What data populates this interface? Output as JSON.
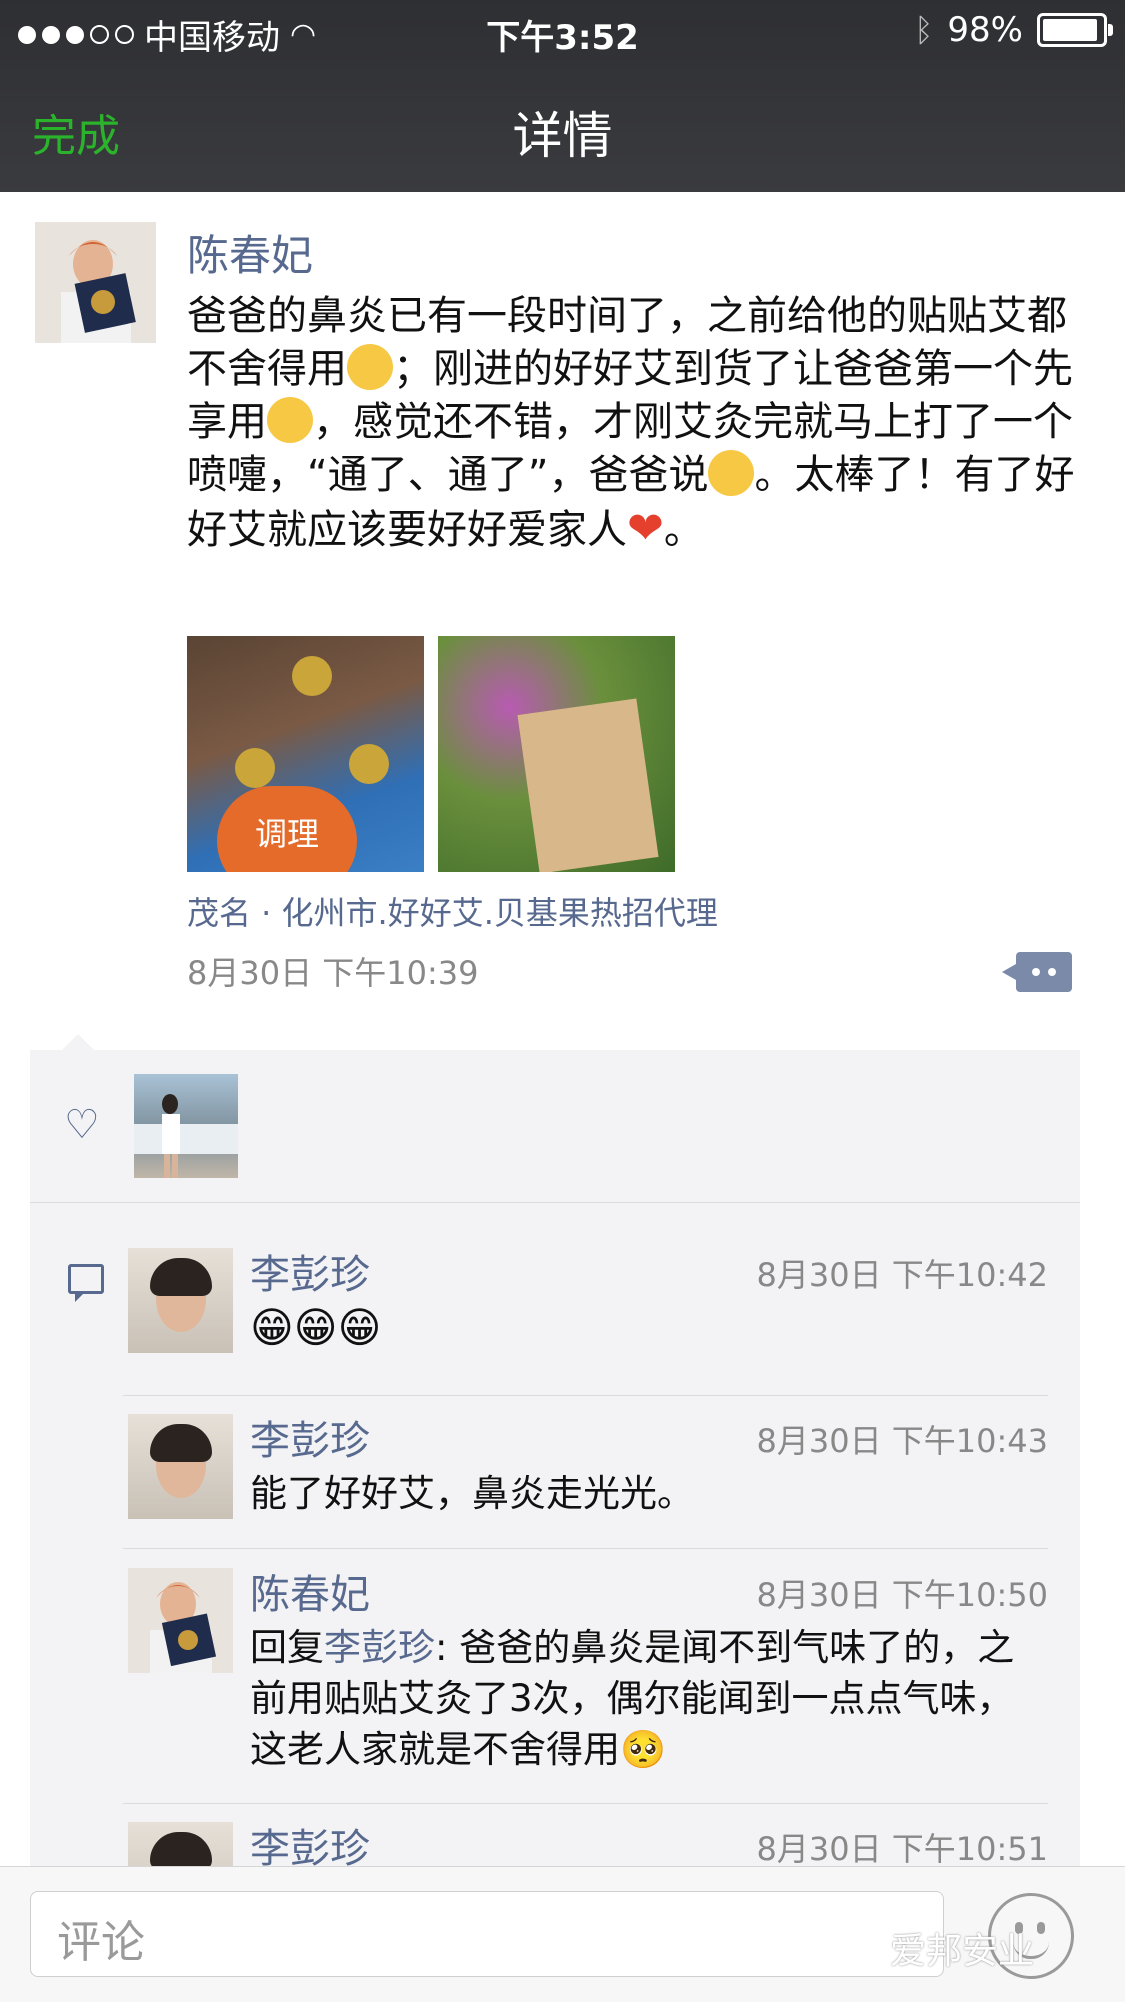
{
  "status_bar": {
    "carrier": "中国移动",
    "time": "下午3:52",
    "battery": "98%"
  },
  "nav": {
    "done_label": "完成",
    "title": "详情"
  },
  "post": {
    "author": "陈春妃",
    "text_parts": [
      "爸爸的鼻炎已有一段时间了，之前给他的贴贴艾都不舍得用",
      "；刚进的好好艾到货了让爸爸第一个先享用",
      "，感觉还不错，才刚艾灸完就马上打了一个喷嚏，“通了、通了”，爸爸说",
      "。太棒了！有了好好艾就应该要好好爱家人",
      "。"
    ],
    "photo1_tag": "调理",
    "location": "茂名 · 化州市.好好艾.贝基果热招代理",
    "timestamp": "8月30日 下午10:39"
  },
  "comments": [
    {
      "name": "李彭珍",
      "time": "8月30日 下午10:42",
      "text": "😁😁😁"
    },
    {
      "name": "李彭珍",
      "time": "8月30日 下午10:43",
      "text": "能了好好艾，鼻炎走光光。"
    },
    {
      "name": "陈春妃",
      "time": "8月30日 下午10:50",
      "reply_prefix": "回复",
      "reply_to": "李彭珍",
      "text": ": 爸爸的鼻炎是闻不到气味了的，之前用贴贴艾灸了3次，偶尔能闻到一点点气味，这老人家就是不舍得用🥺"
    },
    {
      "name": "李彭珍",
      "time": "8月30日 下午10:51",
      "text": ""
    }
  ],
  "input": {
    "placeholder": "评论"
  },
  "watermark": "爱邦安业",
  "colors": {
    "accent_link": "#57698e",
    "done_green": "#2bb32b",
    "nav_bg": "#333438"
  }
}
